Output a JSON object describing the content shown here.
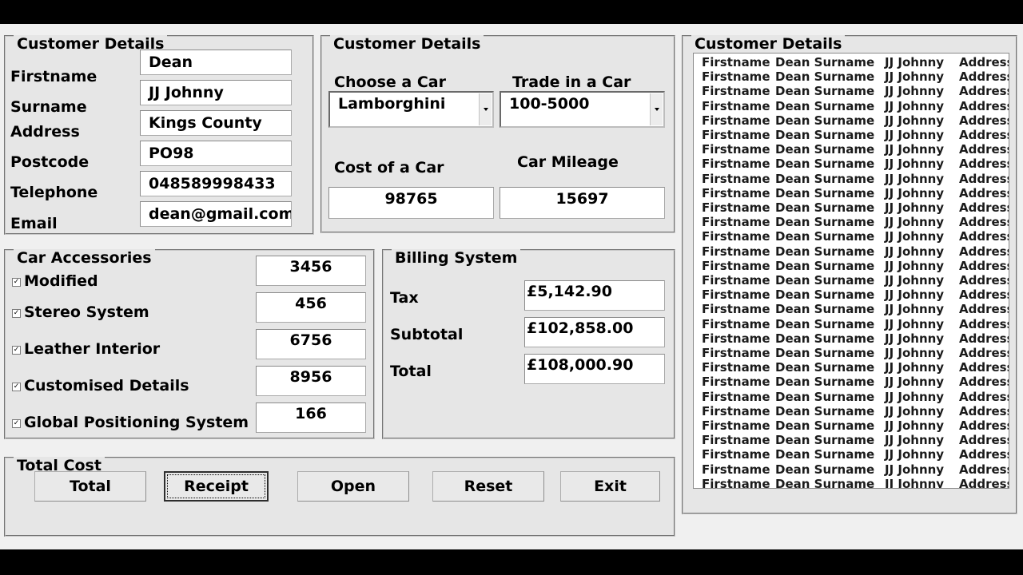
{
  "customer": {
    "legend": "Customer Details",
    "fields": [
      {
        "label": "Firstname",
        "value": "Dean"
      },
      {
        "label": "Surname",
        "value": "JJ Johnny"
      },
      {
        "label": "Address",
        "value": "Kings County"
      },
      {
        "label": "Postcode",
        "value": "PO98"
      },
      {
        "label": "Telephone",
        "value": "048589998433"
      },
      {
        "label": "Email",
        "value": "dean@gmail.com"
      }
    ]
  },
  "car": {
    "legend": "Customer Details",
    "choose_label": "Choose a Car",
    "choose_value": "Lamborghini",
    "trade_label": "Trade in a Car",
    "trade_value": "100-5000",
    "cost_label": "Cost of a Car",
    "cost_value": "98765",
    "mileage_label": "Car Mileage",
    "mileage_value": "15697"
  },
  "accessories": {
    "legend": "Car Accessories",
    "items": [
      {
        "label": "Modified",
        "checked": true,
        "value": "3456"
      },
      {
        "label": "Stereo System",
        "checked": true,
        "value": "456"
      },
      {
        "label": "Leather Interior",
        "checked": true,
        "value": "6756"
      },
      {
        "label": "Customised Details",
        "checked": true,
        "value": "8956"
      },
      {
        "label": "Global Positioning System",
        "checked": true,
        "value": "166"
      }
    ]
  },
  "billing": {
    "legend": "Billing System",
    "tax_label": "Tax",
    "tax_value": "£5,142.90",
    "subtotal_label": "Subtotal",
    "subtotal_value": "£102,858.00",
    "total_label": "Total",
    "total_value": "£108,000.90"
  },
  "total_cost": {
    "legend": "Total Cost",
    "buttons": {
      "total": "Total",
      "receipt": "Receipt",
      "open": "Open",
      "reset": "Reset",
      "exit": "Exit"
    }
  },
  "receipt_panel": {
    "legend": "Customer Details",
    "row_count": 30,
    "row": {
      "c1": "Firstname",
      "c2": "Dean Surname",
      "c3": "JJ Johnny",
      "c4": "Address"
    }
  }
}
